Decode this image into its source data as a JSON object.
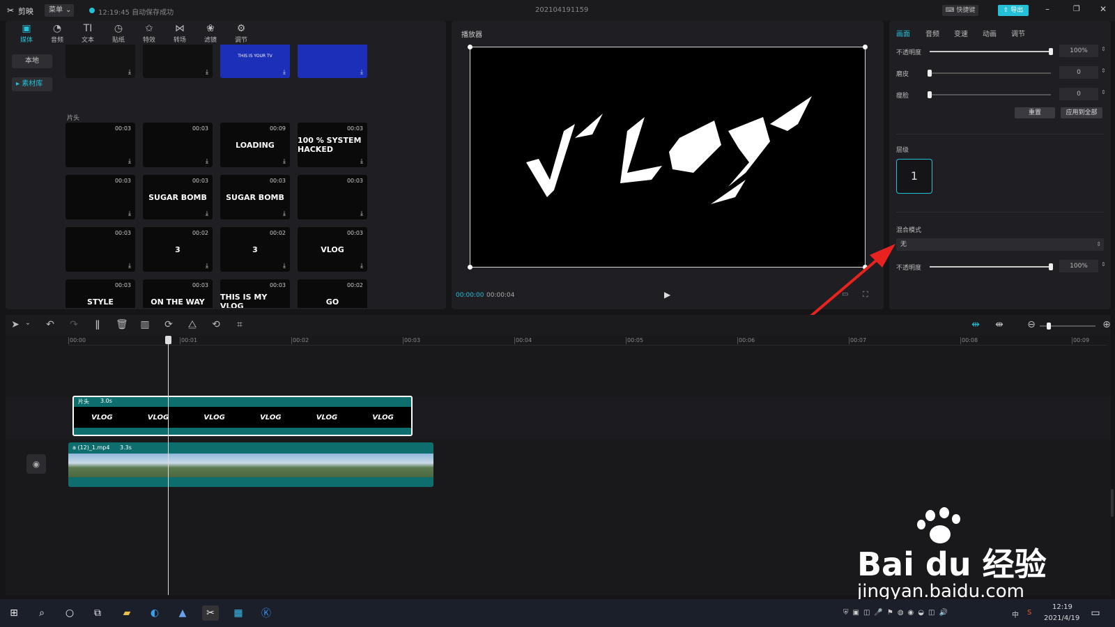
{
  "titlebar": {
    "app_name": "剪映",
    "menu_label": "菜单",
    "autosave_text": "12:19:45 自动保存成功",
    "project_name": "202104191159",
    "shortcut_label": "快捷键",
    "export_label": "导出"
  },
  "media_tabs": [
    "媒体",
    "音频",
    "文本",
    "贴纸",
    "特效",
    "转场",
    "滤镜",
    "调节"
  ],
  "media_sidebar": {
    "local": "本地",
    "library": "素材库"
  },
  "media": {
    "section_label": "片头",
    "top_row": [
      {
        "art": ""
      },
      {
        "art": ""
      },
      {
        "art": "THIS IS YOUR TV"
      },
      {
        "art": ""
      }
    ],
    "items": [
      {
        "duration": "00:03",
        "art": ""
      },
      {
        "duration": "00:03",
        "art": ""
      },
      {
        "duration": "00:09",
        "art": "LOADING"
      },
      {
        "duration": "00:03",
        "art": "100 % SYSTEM HACKED"
      },
      {
        "duration": "00:03",
        "art": ""
      },
      {
        "duration": "00:03",
        "art": "SUGAR BOMB"
      },
      {
        "duration": "00:03",
        "art": "SUGAR BOMB"
      },
      {
        "duration": "00:03",
        "art": ""
      },
      {
        "duration": "00:03",
        "art": ""
      },
      {
        "duration": "00:02",
        "art": "3"
      },
      {
        "duration": "00:02",
        "art": "3"
      },
      {
        "duration": "00:03",
        "art": "VLOG"
      },
      {
        "duration": "00:03",
        "art": "STYLE"
      },
      {
        "duration": "00:03",
        "art": "ON THE WAY"
      },
      {
        "duration": "00:03",
        "art": "THIS IS MY VLOG"
      },
      {
        "duration": "00:02",
        "art": "GO"
      }
    ]
  },
  "player": {
    "title": "播放器",
    "current_time": "00:00:00",
    "total_time": "00:00:04",
    "screen_text": "V'LOG'"
  },
  "props": {
    "tabs": [
      "画面",
      "音频",
      "变速",
      "动画",
      "调节"
    ],
    "rows": [
      {
        "label": "不透明度",
        "value": "100%",
        "level": 1.0
      },
      {
        "label": "磨皮",
        "value": "0",
        "level": 0
      },
      {
        "label": "瘦脸",
        "value": "0",
        "level": 0
      }
    ],
    "reset_label": "重置",
    "apply_all_label": "应用到全部",
    "layer_heading": "层级",
    "layer_value": "1",
    "blend_heading": "混合模式",
    "blend_value": "无",
    "blend_opacity_label": "不透明度",
    "blend_opacity_value": "100%",
    "blend_opacity_level": 1.0
  },
  "timeline": {
    "ruler": [
      "00:00",
      "00:01",
      "00:02",
      "00:03",
      "00:04",
      "00:05",
      "00:06",
      "00:07",
      "00:08",
      "00:09"
    ],
    "clip1": {
      "name": "片头",
      "duration": "3.0s",
      "text": "VLOG"
    },
    "clip2": {
      "name": "a (12)_1.mp4",
      "duration": "3.3s"
    }
  },
  "taskbar": {
    "time": "12:19",
    "date": "2021/4/19",
    "ime": "中"
  },
  "watermark": {
    "brand": "Bai du 经验",
    "url": "jingyan.baidu.com"
  },
  "colors": {
    "accent": "#24c0d8",
    "arrow": "#e8231f"
  }
}
